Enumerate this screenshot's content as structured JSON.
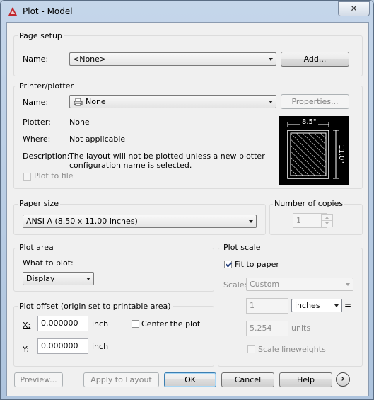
{
  "window": {
    "title": "Plot - Model",
    "close_glyph": "✕"
  },
  "page_setup": {
    "title": "Page setup",
    "name_label": "Name:",
    "name_value": "<None>",
    "add_button": "Add..."
  },
  "printer": {
    "title": "Printer/plotter",
    "name_label": "Name:",
    "name_value": "None",
    "properties_button": "Properties...",
    "plotter_label": "Plotter:",
    "plotter_value": "None",
    "where_label": "Where:",
    "where_value": "Not applicable",
    "description_label": "Description:",
    "description_line1": "The layout will not be plotted unless a new plotter",
    "description_line2": "configuration name is selected.",
    "plot_to_file_label": "Plot to file",
    "plot_to_file_checked": false,
    "preview_width_label": "8.5\"",
    "preview_height_label": "11.0\""
  },
  "paper_size": {
    "title": "Paper size",
    "value": "ANSI A (8.50 x 11.00 Inches)"
  },
  "copies": {
    "title": "Number of copies",
    "value": "1"
  },
  "plot_area": {
    "title": "Plot area",
    "what_label": "What to plot:",
    "what_value": "Display"
  },
  "plot_offset": {
    "title": "Plot offset (origin set to printable area)",
    "x_label": "X:",
    "x_value": "0.000000",
    "x_unit": "inch",
    "y_label": "Y:",
    "y_value": "0.000000",
    "y_unit": "inch",
    "center_label": "Center the plot",
    "center_checked": false
  },
  "plot_scale": {
    "title": "Plot scale",
    "fit_label": "Fit to paper",
    "fit_checked": true,
    "scale_label": "Scale:",
    "scale_value": "Custom",
    "numerator": "1",
    "unit_value": "inches",
    "equals": "=",
    "denominator": "5.254",
    "denominator_unit": "units",
    "lineweights_label": "Scale lineweights",
    "lineweights_checked": false
  },
  "buttons": {
    "preview": "Preview...",
    "apply": "Apply to Layout",
    "ok": "OK",
    "cancel": "Cancel",
    "help": "Help",
    "more_glyph": "›"
  },
  "colors": {
    "title_bg": "#b7c9dd",
    "client_bg": "#f0f0f0",
    "preview_bg": "#000000",
    "app_icon": "#c0272d"
  }
}
